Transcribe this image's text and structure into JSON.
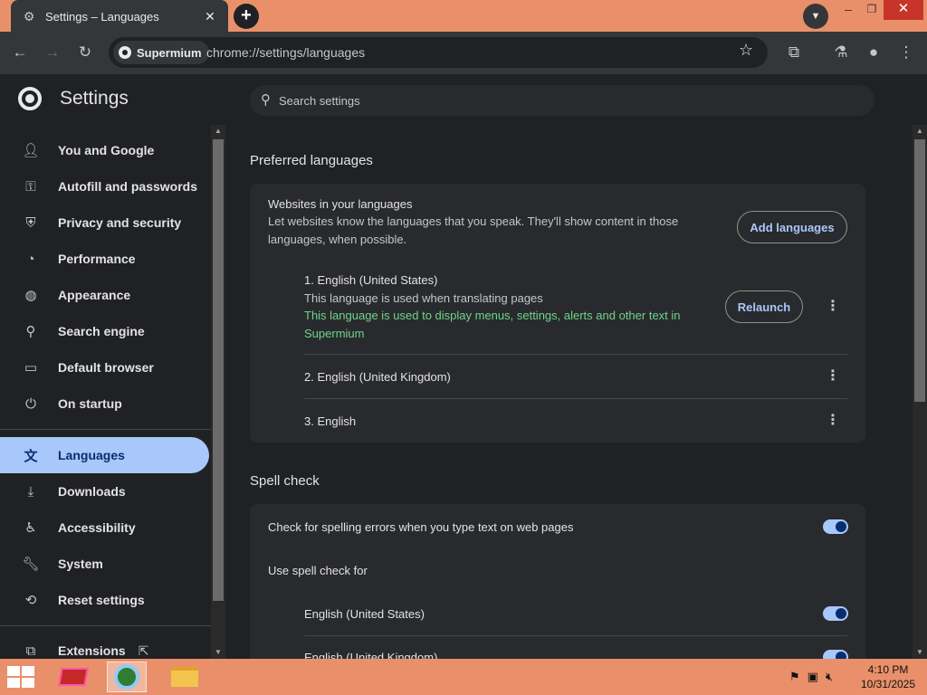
{
  "window": {
    "tab_title": "Settings – Languages",
    "tab_close": "✕",
    "new_tab": "+",
    "minimize": "–",
    "maximize": "❐",
    "close": "✕"
  },
  "toolbar": {
    "chip_label": "Supermium",
    "url": "chrome://settings/languages"
  },
  "sidebar": {
    "title": "Settings",
    "items": [
      {
        "label": "You and Google",
        "icon": "person-icon"
      },
      {
        "label": "Autofill and passwords",
        "icon": "key-icon"
      },
      {
        "label": "Privacy and security",
        "icon": "shield-icon"
      },
      {
        "label": "Performance",
        "icon": "speedometer-icon"
      },
      {
        "label": "Appearance",
        "icon": "palette-icon"
      },
      {
        "label": "Search engine",
        "icon": "search-icon"
      },
      {
        "label": "Default browser",
        "icon": "browser-window-icon"
      },
      {
        "label": "On startup",
        "icon": "power-icon"
      },
      {
        "label": "Languages",
        "icon": "translate-icon"
      },
      {
        "label": "Downloads",
        "icon": "download-icon"
      },
      {
        "label": "Accessibility",
        "icon": "accessibility-icon"
      },
      {
        "label": "System",
        "icon": "wrench-icon"
      },
      {
        "label": "Reset settings",
        "icon": "reset-icon"
      },
      {
        "label": "Extensions",
        "icon": "puzzle-icon"
      }
    ]
  },
  "search": {
    "placeholder": "Search settings"
  },
  "preferred_languages": {
    "section_title": "Preferred languages",
    "websites_title": "Websites in your languages",
    "websites_desc": "Let websites know the languages that you speak. They'll show content in those languages, when possible.",
    "add_button": "Add languages",
    "languages": [
      {
        "name": "1. English (United States)",
        "sub": "This language is used when translating pages",
        "note": "This language is used to display menus, settings, alerts and other text in Supermium",
        "action": "Relaunch"
      },
      {
        "name": "2. English (United Kingdom)"
      },
      {
        "name": "3. English"
      }
    ]
  },
  "spell_check": {
    "section_title": "Spell check",
    "check_label": "Check for spelling errors when you type text on web pages",
    "use_for_label": "Use spell check for",
    "languages": [
      "English (United States)",
      "English (United Kingdom)"
    ]
  },
  "taskbar": {
    "time": "4:10 PM",
    "date": "10/31/2025"
  }
}
